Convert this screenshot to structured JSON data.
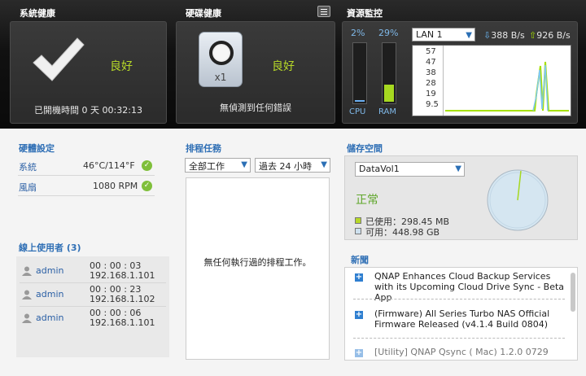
{
  "system_health": {
    "title": "系統健康",
    "status": "良好",
    "uptime": "已開機時間 0 天 00:32:13"
  },
  "disk_health": {
    "title": "硬碟健康",
    "count": "x1",
    "status": "良好",
    "message": "無偵測到任何錯誤"
  },
  "resource_monitor": {
    "title": "資源監控",
    "cpu_pct": "2%",
    "cpu_label": "CPU",
    "cpu_level": 0.02,
    "ram_pct": "29%",
    "ram_label": "RAM",
    "ram_level": 0.29,
    "lan_select": "LAN 1",
    "download": "388 B/s",
    "upload": "926 B/s",
    "y_ticks": [
      "57",
      "47",
      "38",
      "28",
      "19",
      "9.5"
    ],
    "colors": {
      "download_line": "#7fc8f0",
      "upload_line": "#a6e000",
      "ram_fill": "#a6d820",
      "cpu_fill": "#6aaef0"
    }
  },
  "hardware": {
    "title": "硬體設定",
    "rows": [
      {
        "label": "系統",
        "value": "46°C/114°F"
      },
      {
        "label": "風扇",
        "value": "1080 RPM"
      }
    ]
  },
  "online_users": {
    "title": "線上使用者 (3)",
    "users": [
      {
        "name": "admin",
        "time": "00 : 00 : 03",
        "ip": "192.168.1.101"
      },
      {
        "name": "admin",
        "time": "00 : 00 : 23",
        "ip": "192.168.1.102"
      },
      {
        "name": "admin",
        "time": "00 : 00 : 06",
        "ip": "192.168.1.101"
      }
    ]
  },
  "scheduled_tasks": {
    "title": "排程任務",
    "filter_type": "全部工作",
    "filter_time": "過去 24 小時",
    "empty_message": "無任何執行過的排程工作。"
  },
  "storage": {
    "title": "儲存空間",
    "volume": "DataVol1",
    "status": "正常",
    "used": "已使用：298.45 MB",
    "free": "可用：448.98 GB",
    "used_fraction": 0.0006
  },
  "news": {
    "title": "新聞",
    "items": [
      "QNAP Enhances Cloud Backup Services with its Upcoming Cloud Drive Sync - Beta App",
      "(Firmware) All Series Turbo NAS Official Firmware Released (v4.1.4 Build 0804)",
      "[Utility] QNAP Qsync ( Mac) 1.2.0 0729"
    ]
  }
}
